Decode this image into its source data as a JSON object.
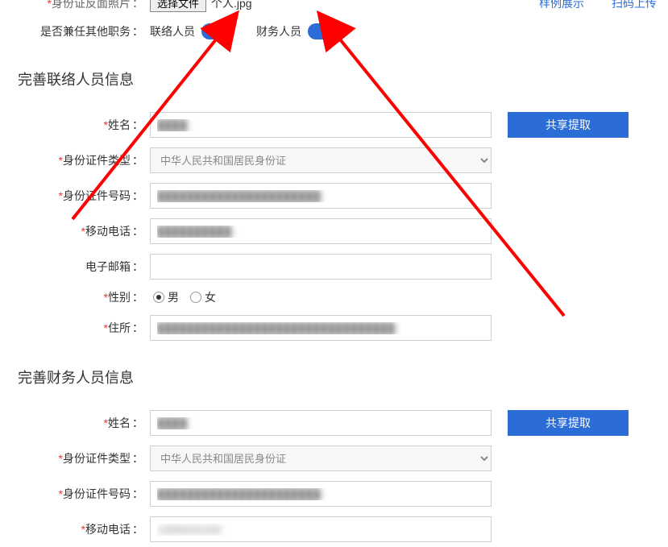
{
  "top": {
    "id_back_label": "身份证反面照片",
    "choose_file_btn": "选择文件",
    "file_name": "个人.jpg",
    "sample_link": "样例展示",
    "scan_upload_link": "扫码上传"
  },
  "toggle_row": {
    "label": "是否兼任其他职务",
    "contact_label": "联络人员",
    "finance_label": "财务人员"
  },
  "contact_section": {
    "title": "完善联络人员信息",
    "name_label": "姓名",
    "id_type_label": "身份证件类型",
    "id_type_value": "中华人民共和国居民身份证",
    "id_no_label": "身份证件号码",
    "phone_label": "移动电话",
    "email_label": "电子邮箱",
    "gender_label": "性别",
    "gender_male": "男",
    "gender_female": "女",
    "address_label": "住所",
    "share_btn": "共享提取"
  },
  "finance_section": {
    "title": "完善财务人员信息",
    "name_label": "姓名",
    "id_type_label": "身份证件类型",
    "id_type_value": "中华人民共和国居民身份证",
    "id_no_label": "身份证件号码",
    "phone_label": "移动电话",
    "share_btn": "共享提取"
  },
  "masks": {
    "a": "████",
    "b": "██████████████████████",
    "c": "██████████",
    "d": "████████████████████████████████",
    "e": "13084031040"
  },
  "colon": "："
}
